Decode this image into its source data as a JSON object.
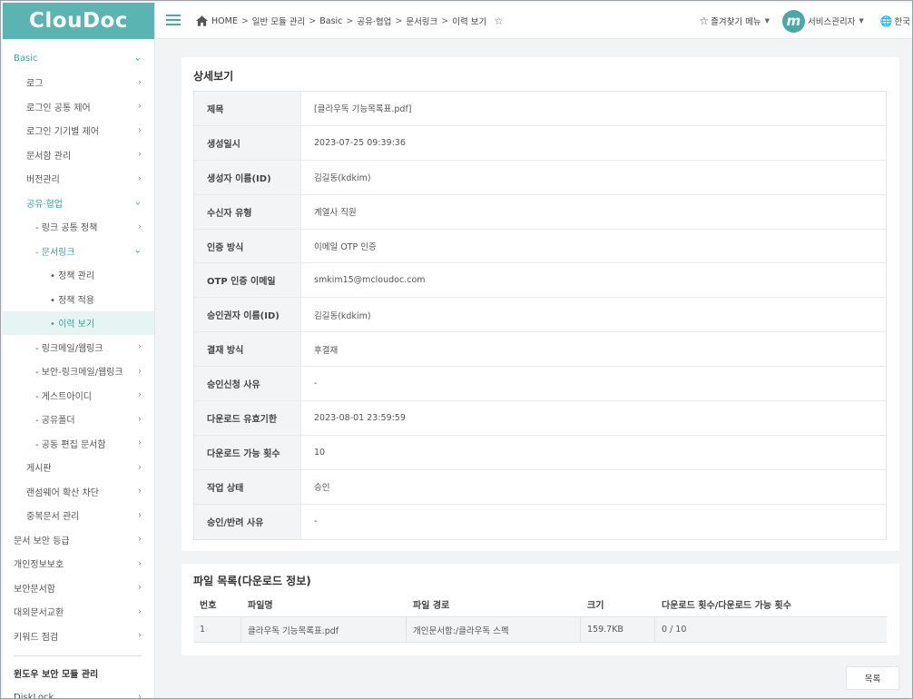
{
  "app": {
    "logo": "ClouDoc"
  },
  "topbar": {
    "breadcrumb": [
      "HOME",
      "일반 모듈 관리",
      "Basic",
      "공유·협업",
      "문서링크",
      "이력 보기"
    ],
    "separator": ">",
    "favorites_label": "즐겨찾기 메뉴",
    "avatar_letter": "m",
    "user_label": "서비스관리자",
    "language_label": "한국"
  },
  "sidebar": {
    "items": [
      {
        "label": "Basic",
        "level": 0,
        "state": "open",
        "chevron": "⌄"
      },
      {
        "label": "로그",
        "level": 1,
        "chevron": "›"
      },
      {
        "label": "로그인 공통 제어",
        "level": 1,
        "chevron": "›"
      },
      {
        "label": "로그인 기기별 제어",
        "level": 1,
        "chevron": "›"
      },
      {
        "label": "문서함 관리",
        "level": 1,
        "chevron": "›"
      },
      {
        "label": "버전관리",
        "level": 1,
        "chevron": "›"
      },
      {
        "label": "공유·협업",
        "level": 1,
        "state": "open",
        "chevron": "⌄"
      },
      {
        "label": "- 링크 공통 정책",
        "level": 2,
        "chevron": "›"
      },
      {
        "label": "- 문서링크",
        "level": 2,
        "state": "open",
        "chevron": "⌄"
      },
      {
        "label": "• 정책 관리",
        "level": 3
      },
      {
        "label": "• 정책 적용",
        "level": 3
      },
      {
        "label": "• 이력 보기",
        "level": 3,
        "state": "active"
      },
      {
        "label": "- 링크메일/웹링크",
        "level": 2,
        "chevron": "›"
      },
      {
        "label": "- 보안-링크메일/웹링크",
        "level": 2,
        "chevron": "›"
      },
      {
        "label": "- 게스트아이디",
        "level": 2,
        "chevron": "›"
      },
      {
        "label": "- 공유폴더",
        "level": 2,
        "chevron": "›"
      },
      {
        "label": "- 공동 편집 문서함",
        "level": 2,
        "chevron": "›"
      },
      {
        "label": "게시판",
        "level": 1,
        "chevron": "›"
      },
      {
        "label": "랜섬웨어 확산 차단",
        "level": 1,
        "chevron": "›"
      },
      {
        "label": "중복문서 관리",
        "level": 1,
        "chevron": "›"
      },
      {
        "label": "문서 보안 등급",
        "level": 0,
        "chevron": "›"
      },
      {
        "label": "개인정보보호",
        "level": 0,
        "chevron": "›"
      },
      {
        "label": "보안문서함",
        "level": 0,
        "chevron": "›"
      },
      {
        "label": "대외문서교환",
        "level": 0,
        "chevron": "›"
      },
      {
        "label": "키워드 점검",
        "level": 0,
        "chevron": "›"
      }
    ],
    "section_title": "윈도우 보안 모듈 관리",
    "after_section": [
      {
        "label": "DiskLock",
        "chevron": "›"
      }
    ]
  },
  "detail": {
    "title": "상세보기",
    "rows": [
      {
        "label": "제목",
        "value": "[클라우독 기능목록표.pdf]"
      },
      {
        "label": "생성일시",
        "value": "2023-07-25 09:39:36"
      },
      {
        "label": "생성자 이름(ID)",
        "value": "김길동(kdkim)"
      },
      {
        "label": "수신자 유형",
        "value": "계열사 직원"
      },
      {
        "label": "인증 방식",
        "value": "이메일 OTP 인증"
      },
      {
        "label": "OTP 인증 이메일",
        "value": "smkim15@mcloudoc.com"
      },
      {
        "label": "승인권자 이름(ID)",
        "value": "김길동(kdkim)"
      },
      {
        "label": "결재 방식",
        "value": "후결재"
      },
      {
        "label": "승인신청 사유",
        "value": "-"
      },
      {
        "label": "다운로드 유효기한",
        "value": "2023-08-01 23:59:59"
      },
      {
        "label": "다운로드 가능 횟수",
        "value": "10"
      },
      {
        "label": "작업 상태",
        "value": "승인"
      },
      {
        "label": "승인/반려 사유",
        "value": "-"
      }
    ]
  },
  "files": {
    "title": "파일 목록(다운로드 정보)",
    "columns": [
      "번호",
      "파일명",
      "파일 경로",
      "크기",
      "다운로드 횟수/다운로드 가능 횟수"
    ],
    "rows": [
      [
        "1",
        "클라우독 기능목록표.pdf",
        "개인문서함:/클라우독 스펙",
        "159.7KB",
        "0 / 10"
      ]
    ]
  },
  "actions": {
    "list_button": "목록"
  }
}
